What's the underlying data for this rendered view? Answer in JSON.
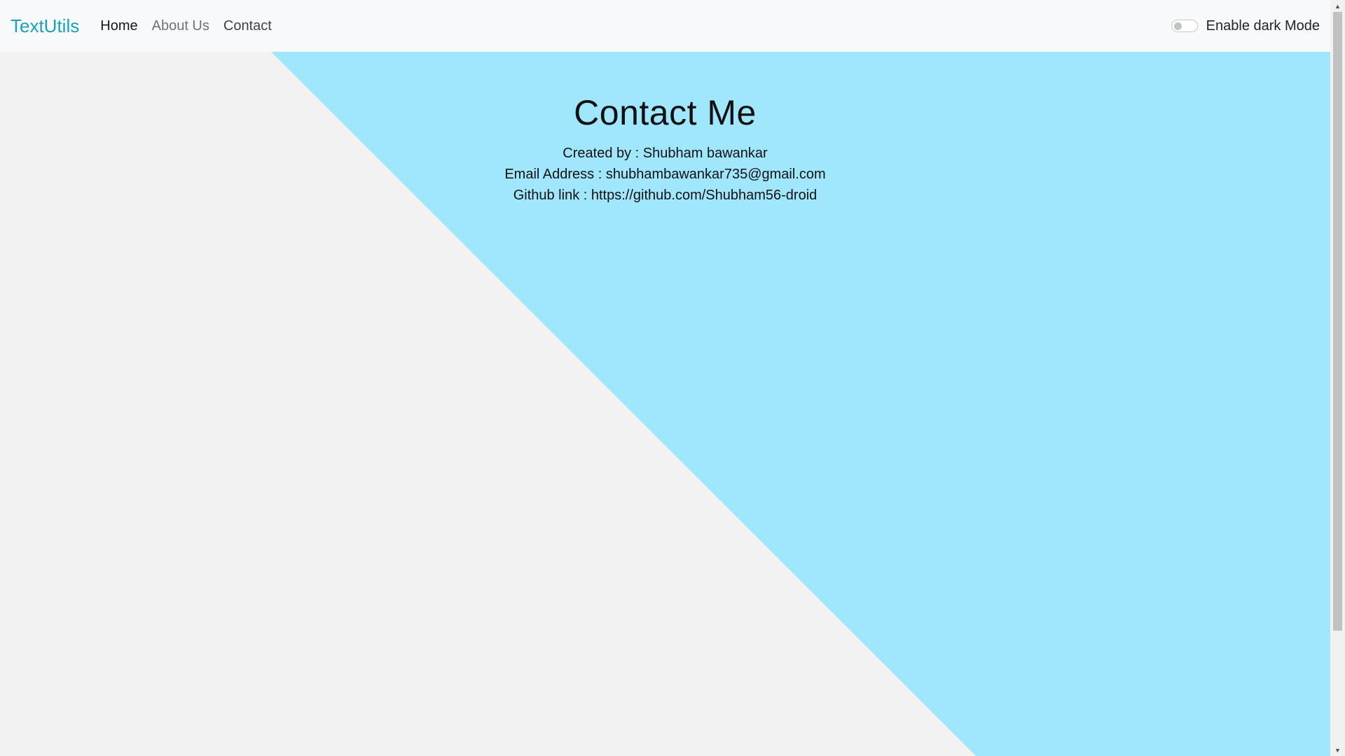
{
  "navbar": {
    "brand": "TextUtils",
    "links": [
      {
        "label": "Home"
      },
      {
        "label": "About Us"
      },
      {
        "label": "Contact"
      }
    ],
    "toggle_label": "Enable dark Mode"
  },
  "contact": {
    "title": "Contact Me",
    "created_by": "Created by : Shubham bawankar",
    "email": "Email Address : shubhambawankar735@gmail.com",
    "github": "Github link : https://github.com/Shubham56-droid"
  },
  "colors": {
    "brand": "#17a2b8",
    "accent_bg": "#a0e7fe",
    "page_bg": "#f2f2f2",
    "navbar_bg": "#f8f9fa"
  }
}
